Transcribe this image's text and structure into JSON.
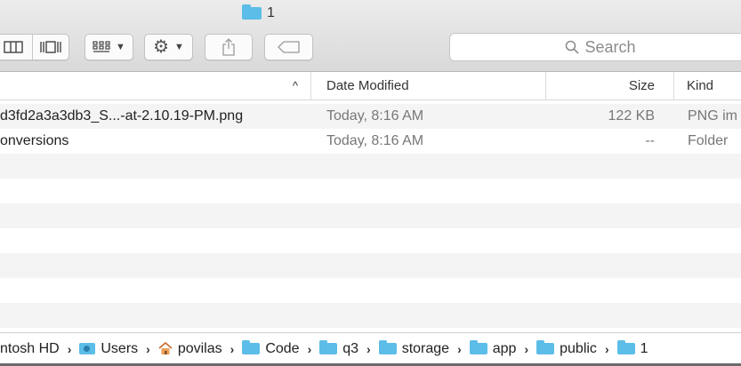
{
  "window": {
    "title": "1",
    "folder_icon": "folder-icon"
  },
  "toolbar": {
    "view_icons": [
      "column-view-icon",
      "cover-flow-view-icon"
    ],
    "group_icon": "grid-group-icon",
    "action_icon": "gear-icon",
    "share_icon": "share-icon",
    "tag_icon": "tag-icon",
    "search_placeholder": "Search"
  },
  "columns": {
    "sort_indicator": "^",
    "date": "Date Modified",
    "size": "Size",
    "kind": "Kind"
  },
  "files": [
    {
      "name": "d3fd2a3a3db3_S...-at-2.10.19-PM.png",
      "date": "Today, 8:16 AM",
      "size": "122 KB",
      "kind": "PNG im"
    },
    {
      "name": "onversions",
      "date": "Today, 8:16 AM",
      "size": "--",
      "kind": "Folder"
    }
  ],
  "empty_rows": 8,
  "path": [
    {
      "label": "ntosh HD",
      "icon": ""
    },
    {
      "label": "Users",
      "icon": "users-folder-icon"
    },
    {
      "label": "povilas",
      "icon": "home-icon"
    },
    {
      "label": "Code",
      "icon": "folder-icon"
    },
    {
      "label": "q3",
      "icon": "folder-icon"
    },
    {
      "label": "storage",
      "icon": "folder-icon"
    },
    {
      "label": "app",
      "icon": "folder-icon"
    },
    {
      "label": "public",
      "icon": "folder-icon"
    },
    {
      "label": "1",
      "icon": "folder-icon"
    }
  ],
  "colors": {
    "folder": "#5cbde8",
    "stripe": "#f4f4f4"
  }
}
